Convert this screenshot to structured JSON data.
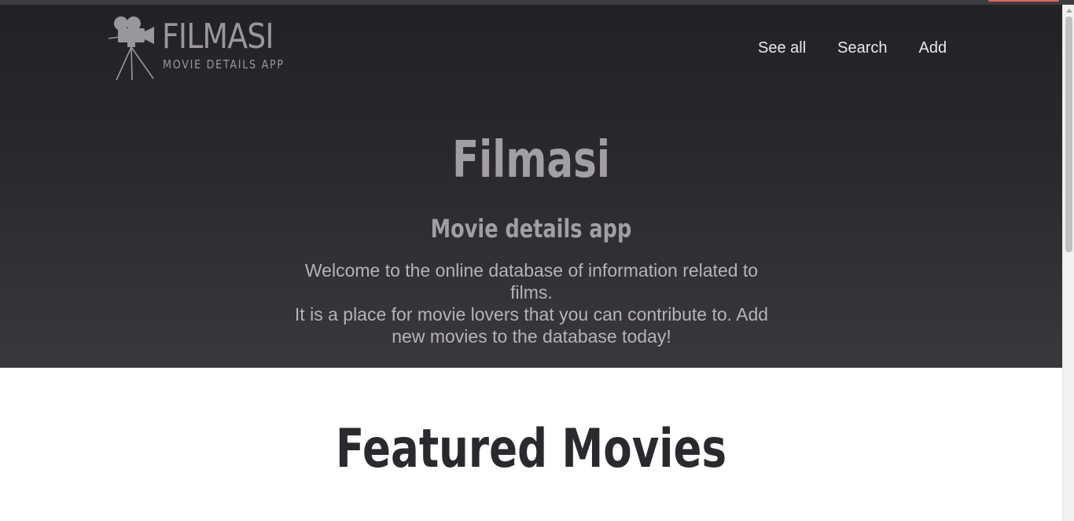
{
  "logo": {
    "title": "FILMASI",
    "subtitle": "MOVIE DETAILS APP",
    "icon": "movie-camera-tripod-icon"
  },
  "nav": {
    "items": [
      {
        "label": "See all"
      },
      {
        "label": "Search"
      },
      {
        "label": "Add"
      }
    ]
  },
  "hero": {
    "title": "Filmasi",
    "subtitle": "Movie details app",
    "description": [
      "Welcome to the online database of information related to films.",
      "It is a place for movie lovers that you can contribute to. Add new movies to the database today!"
    ]
  },
  "featured": {
    "heading": "Featured Movies"
  },
  "colors": {
    "hero_bg_top": "#232126",
    "hero_bg_bottom": "#3a383c",
    "hero_text": "#a19ea4",
    "nav_text": "#e9e8ea",
    "featured_text": "#2b292e",
    "accent": "#e0675c"
  }
}
